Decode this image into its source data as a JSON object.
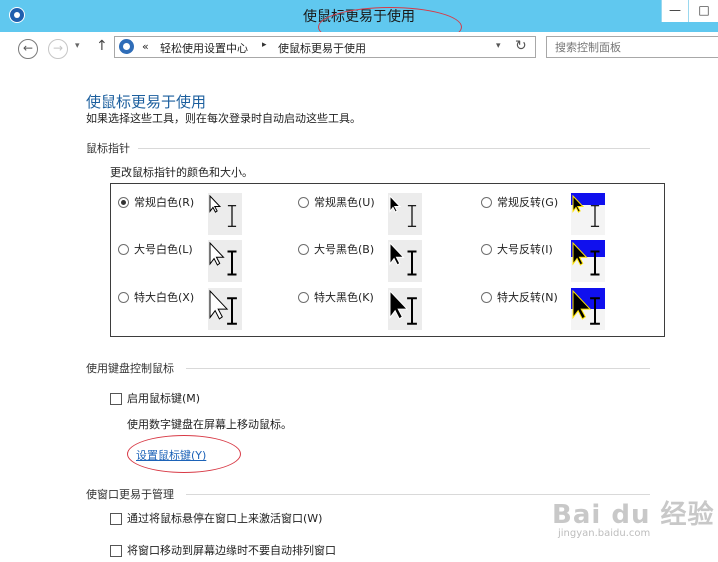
{
  "window": {
    "title": "使鼠标更易于使用",
    "min_glyph": "—",
    "max_glyph": "□"
  },
  "nav": {
    "back_glyph": "←",
    "forward_glyph": "→",
    "dropdown_glyph": "▾",
    "up_glyph": "↑"
  },
  "address": {
    "overflow": "«",
    "separator": "▸",
    "crumbs": [
      "轻松使用设置中心",
      "使鼠标更易于使用"
    ],
    "dropdown_glyph": "▾",
    "refresh_glyph": "↻"
  },
  "search": {
    "placeholder": "搜索控制面板"
  },
  "page": {
    "title": "使鼠标更易于使用",
    "description": "如果选择这些工具，则在每次登录时自动启动这些工具。"
  },
  "pointers": {
    "heading": "鼠标指针",
    "subtitle": "更改鼠标指针的颜色和大小。",
    "schemes": [
      {
        "label": "常规白色(R)",
        "style": "white",
        "size": "regular",
        "checked": true
      },
      {
        "label": "常规黑色(U)",
        "style": "black",
        "size": "regular",
        "checked": false
      },
      {
        "label": "常规反转(G)",
        "style": "inverted",
        "size": "regular",
        "checked": false
      },
      {
        "label": "大号白色(L)",
        "style": "white",
        "size": "large",
        "checked": false
      },
      {
        "label": "大号黑色(B)",
        "style": "black",
        "size": "large",
        "checked": false
      },
      {
        "label": "大号反转(I)",
        "style": "inverted",
        "size": "large",
        "checked": false
      },
      {
        "label": "特大白色(X)",
        "style": "white",
        "size": "xlarge",
        "checked": false
      },
      {
        "label": "特大黑色(K)",
        "style": "black",
        "size": "xlarge",
        "checked": false
      },
      {
        "label": "特大反转(N)",
        "style": "inverted",
        "size": "xlarge",
        "checked": false
      }
    ]
  },
  "keyboard": {
    "heading": "使用键盘控制鼠标",
    "mousekeys_label": "启用鼠标键(M)",
    "mousekeys_checked": false,
    "mousekeys_desc": "使用数字键盘在屏幕上移动鼠标。",
    "setup_link": "设置鼠标键(Y)"
  },
  "windows": {
    "heading": "使窗口更易于管理",
    "activate_hover_label": "通过将鼠标悬停在窗口上来激活窗口(W)",
    "no_snap_label": "将窗口移动到屏幕边缘时不要自动排列窗口"
  },
  "watermark": {
    "brand": "Bai du 经验",
    "url": "jingyan.baidu.com"
  },
  "colors": {
    "titlebar": "#60c8ef",
    "heading_blue": "#1c5f9e",
    "link_blue": "#1d63b8",
    "annotation_red": "#d83a46",
    "inverted_bg": "#1010ee"
  }
}
